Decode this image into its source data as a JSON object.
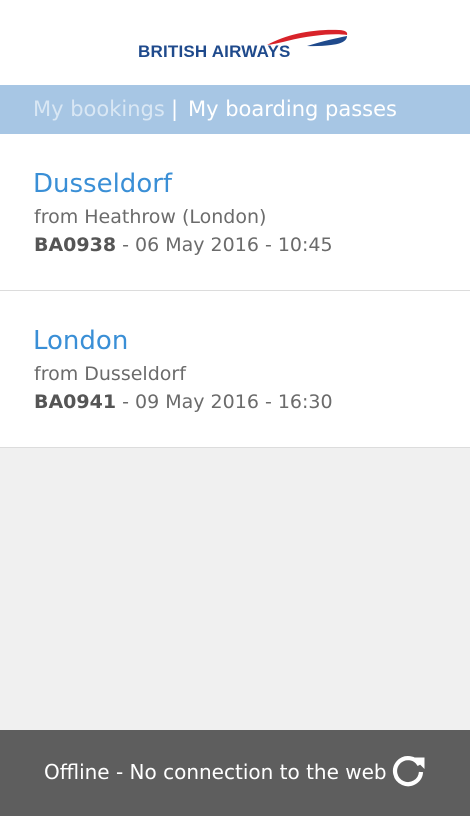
{
  "header": {
    "logo_text": "BRITISH AIRWAYS",
    "brand_colors": {
      "navy": "#1f4a8c",
      "red": "#d8232a"
    }
  },
  "tabs": {
    "bookings_label": "My bookings",
    "separator": "|",
    "passes_label": "My boarding passes",
    "active": "My boarding passes"
  },
  "bookings": [
    {
      "destination": "Dusseldorf",
      "origin": "from Heathrow (London)",
      "flight": "BA0938",
      "date_time": " - 06 May 2016 - 10:45"
    },
    {
      "destination": "London",
      "origin": "from Dusseldorf",
      "flight": "BA0941",
      "date_time": " - 09 May 2016 - 16:30"
    }
  ],
  "status_bar": {
    "message": "Offline - No connection to the web",
    "action_icon": "refresh-icon"
  }
}
